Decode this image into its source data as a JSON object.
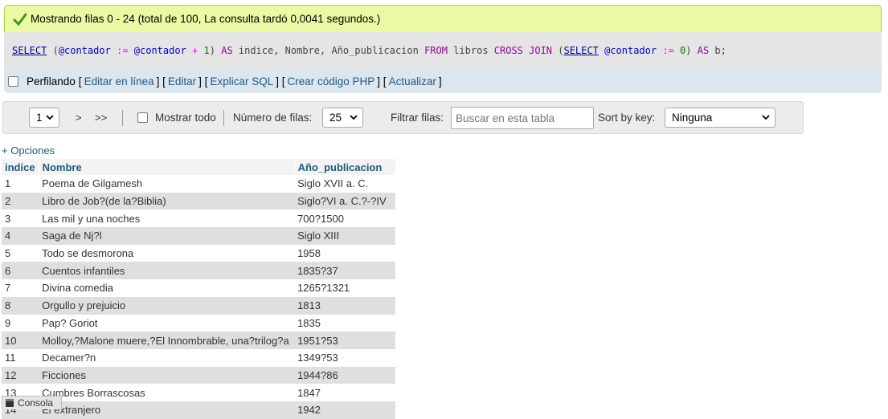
{
  "success": {
    "message": "Mostrando filas 0 - 24 (total de 100, La consulta tardó 0,0041 segundos.)"
  },
  "sql": {
    "tokens": [
      {
        "t": "SELECT",
        "c": "fn"
      },
      {
        "t": " ",
        "c": "plain"
      },
      {
        "t": "(",
        "c": "plain"
      },
      {
        "t": "@contador",
        "c": "var"
      },
      {
        "t": " ",
        "c": "plain"
      },
      {
        "t": ":=",
        "c": "op"
      },
      {
        "t": " ",
        "c": "plain"
      },
      {
        "t": "@contador",
        "c": "var"
      },
      {
        "t": " ",
        "c": "plain"
      },
      {
        "t": "+",
        "c": "op"
      },
      {
        "t": " ",
        "c": "plain"
      },
      {
        "t": "1",
        "c": "num"
      },
      {
        "t": ") ",
        "c": "plain"
      },
      {
        "t": "AS",
        "c": "kw"
      },
      {
        "t": " indice, Nombre, Año_publicacion ",
        "c": "plain"
      },
      {
        "t": "FROM",
        "c": "kw"
      },
      {
        "t": " libros ",
        "c": "plain"
      },
      {
        "t": "CROSS JOIN",
        "c": "kw"
      },
      {
        "t": " (",
        "c": "plain"
      },
      {
        "t": "SELECT",
        "c": "fn"
      },
      {
        "t": " ",
        "c": "plain"
      },
      {
        "t": "@contador",
        "c": "var"
      },
      {
        "t": " ",
        "c": "plain"
      },
      {
        "t": ":=",
        "c": "op"
      },
      {
        "t": " ",
        "c": "plain"
      },
      {
        "t": "0",
        "c": "num"
      },
      {
        "t": ") ",
        "c": "plain"
      },
      {
        "t": "AS",
        "c": "kw"
      },
      {
        "t": " b;",
        "c": "plain"
      }
    ]
  },
  "profile": {
    "label": "Perfilando",
    "links": [
      "Editar en línea",
      "Editar",
      "Explicar SQL",
      "Crear código PHP",
      "Actualizar"
    ]
  },
  "nav": {
    "page_value": "1",
    "next": ">",
    "last": ">>",
    "show_all_label": "Mostrar todo",
    "rows_label": "Número de filas:",
    "rows_value": "25",
    "filter_label": "Filtrar filas:",
    "filter_placeholder": "Buscar en esta tabla",
    "sort_label": "Sort by key:",
    "sort_value": "Ninguna"
  },
  "options_link": "+ Opciones",
  "table": {
    "headers": [
      "indice",
      "Nombre",
      "Año_publicacion"
    ],
    "rows": [
      [
        "1",
        "Poema de Gilgamesh",
        "Siglo XVII a. C."
      ],
      [
        "2",
        "Libro de Job?(de la?Biblia)",
        "Siglo?VI a. C.?-?IV"
      ],
      [
        "3",
        "Las mil y una noches",
        "700?1500"
      ],
      [
        "4",
        "Saga de Nj?l",
        "Siglo XIII"
      ],
      [
        "5",
        "Todo se desmorona",
        "1958"
      ],
      [
        "6",
        "Cuentos infantiles",
        "1835?37"
      ],
      [
        "7",
        "Divina comedia",
        "1265?1321"
      ],
      [
        "8",
        "Orgullo y prejuicio",
        "1813"
      ],
      [
        "9",
        "Pap? Goriot",
        "1835"
      ],
      [
        "10",
        "Molloy,?Malone muere,?El Innombrable, una?trilog?a",
        "1951?53"
      ],
      [
        "11",
        "Decamer?n",
        "1349?53"
      ],
      [
        "12",
        "Ficciones",
        "1944?86"
      ],
      [
        "13",
        "Cumbres Borrascosas",
        "1847"
      ],
      [
        "14",
        "El extranjero",
        "1942"
      ]
    ]
  },
  "console": {
    "label": "Consola"
  },
  "colors": {
    "success_bg": "#ebf8a4",
    "link": "#235a81",
    "row_alt": "#dfdfdf"
  }
}
